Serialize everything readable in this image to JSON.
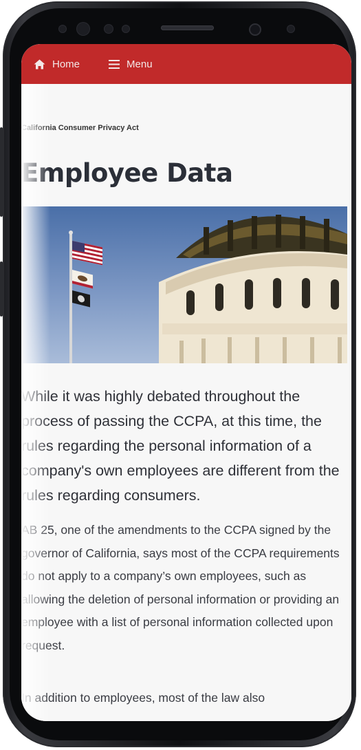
{
  "nav": {
    "home_label": "Home",
    "menu_label": "Menu"
  },
  "colors": {
    "topbar": "#c12a2a",
    "title": "#2b2f38"
  },
  "article": {
    "eyebrow": "California Consumer Privacy Act",
    "title": "Employee Data",
    "lead": "While it was highly debated throughout the process of passing the CCPA, at this time, the rules regarding the personal information of a company's own employees are different from the rules regarding consumers.",
    "paragraph_1": "AB 25, one of the amendments to the CCPA signed by the governor of California, says most of the CCPA requirements do not apply to a company’s own employees, such as allowing the deletion of personal information or providing an employee with a list of personal information collected upon request.",
    "paragraph_2": "In addition to employees, most of the law also"
  },
  "icons": {
    "home": "home-icon",
    "menu": "hamburger-menu-icon"
  }
}
